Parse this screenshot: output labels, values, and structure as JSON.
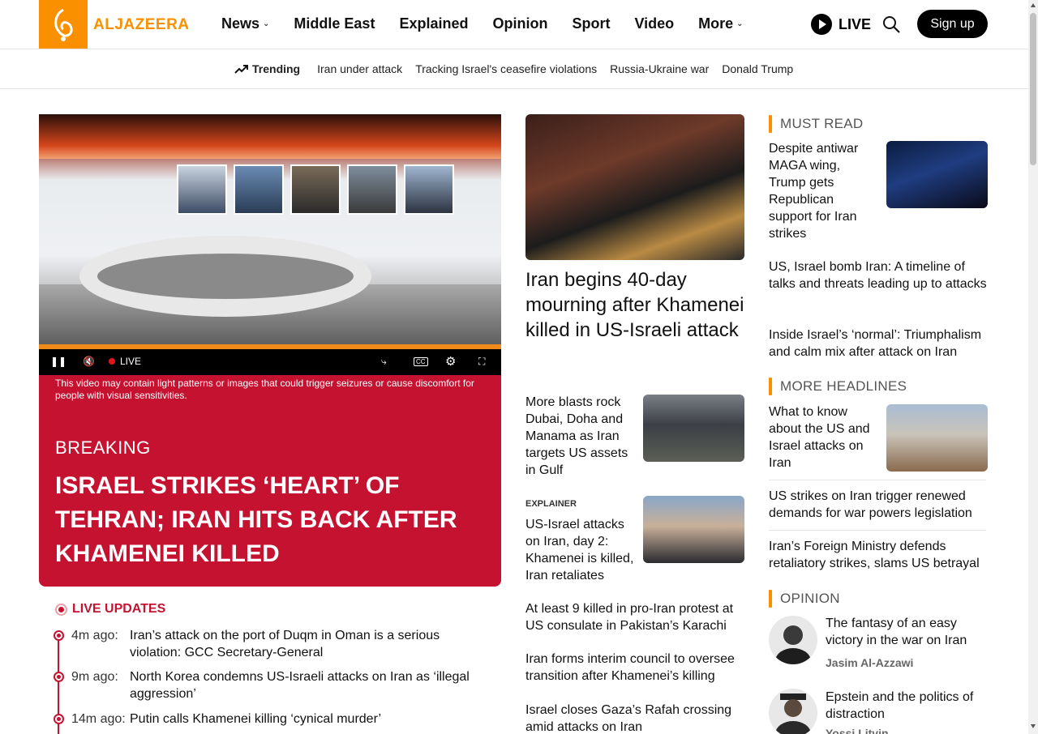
{
  "header": {
    "logo_text": "ALJAZEERA",
    "nav": [
      {
        "label": "News",
        "dropdown": true
      },
      {
        "label": "Middle East",
        "dropdown": false
      },
      {
        "label": "Explained",
        "dropdown": false
      },
      {
        "label": "Opinion",
        "dropdown": false
      },
      {
        "label": "Sport",
        "dropdown": false
      },
      {
        "label": "Video",
        "dropdown": false
      },
      {
        "label": "More",
        "dropdown": true
      }
    ],
    "live_label": "LIVE",
    "signup_label": "Sign up"
  },
  "trending": {
    "label": "Trending",
    "links": [
      "Iran under attack",
      "Tracking Israel's ceasefire violations",
      "Russia-Ukraine war",
      "Donald Trump"
    ]
  },
  "video": {
    "live_label": "LIVE",
    "warning": "This video may contain light patterns or images that could trigger seizures or cause discomfort for people with visual sensitivities."
  },
  "breaking": {
    "label": "BREAKING",
    "headline": "ISRAEL STRIKES ‘HEART’ OF TEHRAN; IRAN HITS BACK AFTER KHAMENEI KILLED"
  },
  "live_updates": {
    "title": "LIVE UPDATES",
    "items": [
      {
        "time": "4m ago:",
        "text": "Iran’s attack on the port of Duqm in Oman is a serious violation: GCC Secretary-General"
      },
      {
        "time": "9m ago:",
        "text": "North Korea condemns US-Israeli attacks on Iran as ‘illegal aggression’"
      },
      {
        "time": "14m ago:",
        "text": "Putin calls Khamenei killing ‘cynical murder’"
      }
    ]
  },
  "middle": {
    "main_headline": "Iran begins 40-day mourning after Khamenei killed in US-Israeli attack",
    "stories": [
      {
        "title": "More blasts rock Dubai, Doha and Manama as Iran targets US assets in Gulf",
        "tag": ""
      },
      {
        "title": "US-Israel attacks on Iran, day 2: Khamenei is killed, Iran retaliates",
        "tag": "EXPLAINER"
      }
    ],
    "links": [
      "At least 9 killed in pro-Iran protest at US consulate in Pakistan’s Karachi",
      "Iran forms interim council to oversee transition after Khamenei’s killing",
      "Israel closes Gaza’s Rafah crossing amid attacks on Iran"
    ]
  },
  "right": {
    "must_read": {
      "title": "MUST READ",
      "feature": "Despite antiwar MAGA wing, Trump gets Republican support for Iran strikes",
      "links": [
        "US, Israel bomb Iran: A timeline of talks and threats leading up to attacks",
        "Inside Israel’s ‘normal’: Triumphalism and calm mix after attack on Iran"
      ]
    },
    "more_headlines": {
      "title": "MORE HEADLINES",
      "feature": "What to know about the US and Israel attacks on Iran",
      "links": [
        "US strikes on Iran trigger renewed demands for war powers legislation",
        "Iran’s Foreign Ministry defends retaliatory strikes, slams US betrayal"
      ]
    },
    "opinion": {
      "title": "OPINION",
      "items": [
        {
          "title": "The fantasy of an easy victory in the war on Iran",
          "author": "Jasim Al-Azzawi"
        },
        {
          "title": "Epstein and the politics of distraction",
          "author": "Yossi Litvin"
        }
      ]
    }
  },
  "colors": {
    "brand_orange": "#fa9000",
    "breaking_red": "#c41230"
  }
}
